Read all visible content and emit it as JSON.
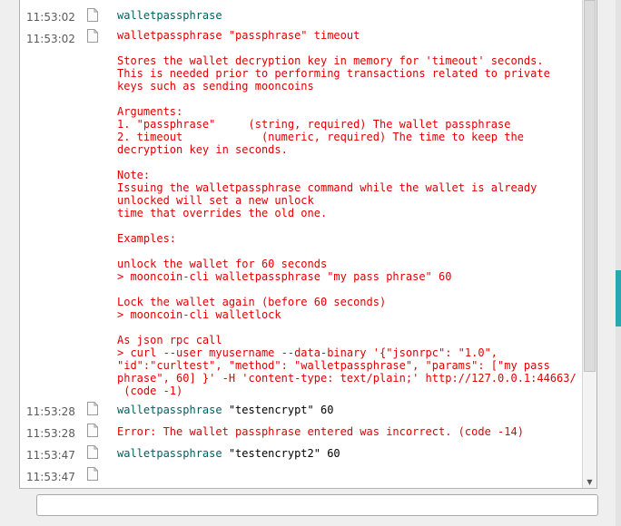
{
  "console": {
    "entries": [
      {
        "time": "11:53:02",
        "kind": "cmd",
        "command": "walletpassphrase",
        "args": ""
      },
      {
        "time": "11:53:02",
        "kind": "reply",
        "text": "walletpassphrase \"passphrase\" timeout\n\nStores the wallet decryption key in memory for 'timeout' seconds.\nThis is needed prior to performing transactions related to private\nkeys such as sending mooncoins\n\nArguments:\n1. \"passphrase\"     (string, required) The wallet passphrase\n2. timeout            (numeric, required) The time to keep the\ndecryption key in seconds.\n\nNote:\nIssuing the walletpassphrase command while the wallet is already\nunlocked will set a new unlock\ntime that overrides the old one.\n\nExamples:\n\nunlock the wallet for 60 seconds\n> mooncoin-cli walletpassphrase \"my pass phrase\" 60\n\nLock the wallet again (before 60 seconds)\n> mooncoin-cli walletlock\n\nAs json rpc call\n> curl --user myusername --data-binary '{\"jsonrpc\": \"1.0\",\n\"id\":\"curltest\", \"method\": \"walletpassphrase\", \"params\": [\"my pass\nphrase\", 60] }' -H 'content-type: text/plain;' http://127.0.0.1:44663/\n (code -1)"
      },
      {
        "time": "11:53:28",
        "kind": "cmd",
        "command": "walletpassphrase",
        "args": " \"testencrypt\" 60"
      },
      {
        "time": "11:53:28",
        "kind": "reply",
        "text": "Error: The wallet passphrase entered was incorrect. (code -14)"
      },
      {
        "time": "11:53:47",
        "kind": "cmd",
        "command": "walletpassphrase",
        "args": " \"testencrypt2\" 60"
      },
      {
        "time": "11:53:47",
        "kind": "reply",
        "text": ""
      }
    ]
  },
  "input": {
    "value": "",
    "placeholder": ""
  },
  "colors": {
    "command": "#006060",
    "reply": "#e00000",
    "accent": "#29a8b1"
  },
  "icons": {
    "entry": "document-icon",
    "scroll_down": "arrow-down-icon"
  }
}
